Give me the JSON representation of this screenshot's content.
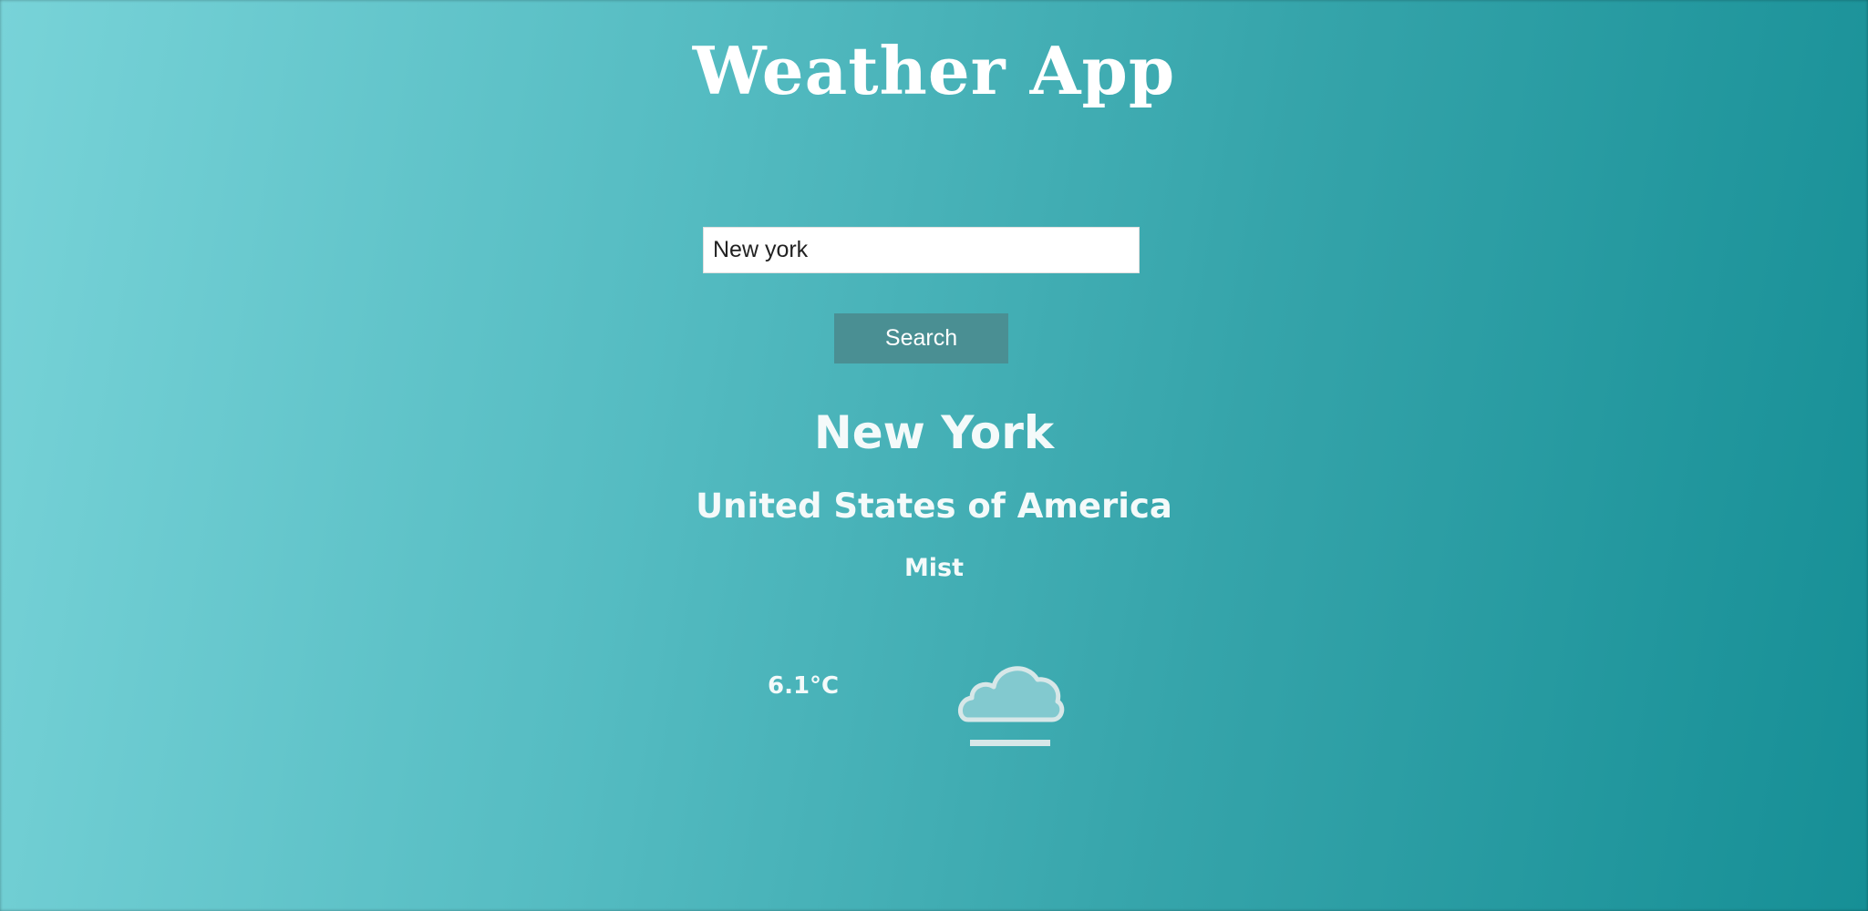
{
  "app": {
    "title": "Weather App"
  },
  "search": {
    "value": "New york",
    "button_label": "Search"
  },
  "weather": {
    "city": "New York",
    "country": "United States of America",
    "condition": "Mist",
    "temperature": "6.1°C",
    "icon": "mist-cloud-icon"
  }
}
